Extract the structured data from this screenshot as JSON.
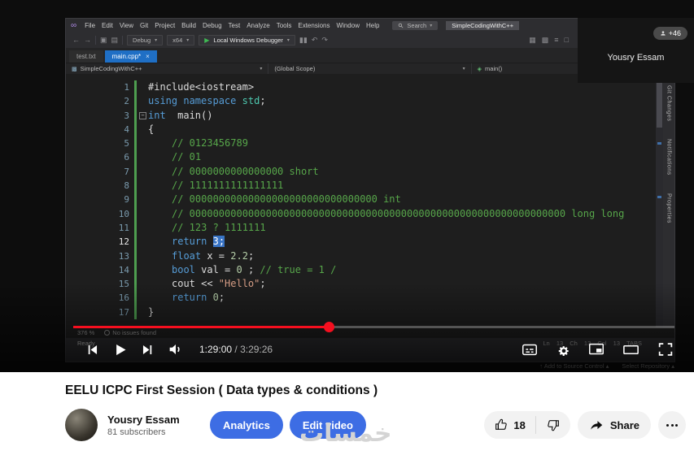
{
  "colors": {
    "accent_blue": "#3d6de4",
    "progress_red": "#f50f1f",
    "kw": "#569cd6",
    "comment": "#57a64a",
    "string": "#d69d85",
    "number": "#b5cea8",
    "selection": "#3873c4"
  },
  "video": {
    "overlay": {
      "badge": "+46",
      "presenter": "Yousry Essam"
    },
    "player": {
      "time_current": "1:29:00",
      "time_sep": " / ",
      "time_total": "3:29:26",
      "progress_pct": 42.5
    }
  },
  "vs": {
    "menus": [
      "File",
      "Edit",
      "View",
      "Git",
      "Project",
      "Build",
      "Debug",
      "Test",
      "Analyze",
      "Tools",
      "Extensions",
      "Window",
      "Help"
    ],
    "search_label": "Search",
    "account_label": "SimpleCodingWithC++",
    "toolbar": {
      "config": "Debug",
      "platform": "x64",
      "run": "Local Windows Debugger"
    },
    "tabs": [
      {
        "label": "test.txt"
      },
      {
        "label": "main.cpp*"
      }
    ],
    "breadcrumb": {
      "project": "SimpleCodingWithC++",
      "scope": "(Global Scope)",
      "symbol": "main()"
    },
    "right_tabs": [
      "Git Changes",
      "Notifications",
      "Properties"
    ],
    "status": {
      "zoom": "376 %",
      "issues": "No issues found",
      "ready": "Ready",
      "caret": "Ln 13 Ch 13 Col 13 TABS",
      "source_control": "Add to Source Control",
      "repository": "Select Repository"
    },
    "code": {
      "lines": [
        {
          "n": 1,
          "ind": 0,
          "segs": [
            [
              "pl",
              "#include<iostream>"
            ]
          ]
        },
        {
          "n": 2,
          "ind": 0,
          "segs": [
            [
              "kw",
              "using"
            ],
            [
              "pl",
              " "
            ],
            [
              "kw",
              "namespace"
            ],
            [
              "pl",
              " "
            ],
            [
              "ty",
              "std"
            ],
            [
              "pl",
              ";"
            ]
          ]
        },
        {
          "n": 3,
          "ind": 0,
          "fold": true,
          "segs": [
            [
              "kw",
              "int"
            ],
            [
              "pl",
              "  main()"
            ]
          ]
        },
        {
          "n": 4,
          "ind": 0,
          "segs": [
            [
              "pl",
              "{"
            ]
          ]
        },
        {
          "n": 5,
          "ind": 1,
          "segs": [
            [
              "cm",
              "// 0123456789"
            ]
          ]
        },
        {
          "n": 6,
          "ind": 1,
          "segs": [
            [
              "cm",
              "// 01"
            ]
          ]
        },
        {
          "n": 7,
          "ind": 1,
          "segs": [
            [
              "cm",
              "// 0000000000000000 short"
            ]
          ]
        },
        {
          "n": 8,
          "ind": 1,
          "segs": [
            [
              "cm",
              "// 1111111111111111"
            ]
          ]
        },
        {
          "n": 9,
          "ind": 1,
          "segs": [
            [
              "cm",
              "// 00000000000000000000000000000000 int"
            ]
          ]
        },
        {
          "n": 10,
          "ind": 1,
          "segs": [
            [
              "cm",
              "// 0000000000000000000000000000000000000000000000000000000000000000 long long"
            ]
          ]
        },
        {
          "n": 11,
          "ind": 1,
          "segs": [
            [
              "cm",
              "// 123 ? 1111111"
            ]
          ]
        },
        {
          "n": 12,
          "ind": 1,
          "cur": true,
          "segs": [
            [
              "kw",
              "return"
            ],
            [
              "pl",
              " "
            ],
            [
              "sel",
              "3;"
            ]
          ]
        },
        {
          "n": 13,
          "ind": 1,
          "segs": [
            [
              "kw",
              "float"
            ],
            [
              "pl",
              " x = "
            ],
            [
              "num",
              "2.2"
            ],
            [
              "pl",
              ";"
            ]
          ]
        },
        {
          "n": 14,
          "ind": 1,
          "segs": [
            [
              "kw",
              "bool"
            ],
            [
              "pl",
              " val = "
            ],
            [
              "num",
              "0"
            ],
            [
              "pl",
              " ; "
            ],
            [
              "cm",
              "// true = 1 /"
            ]
          ]
        },
        {
          "n": 15,
          "ind": 1,
          "segs": [
            [
              "pl",
              "cout << "
            ],
            [
              "str",
              "\"Hello\""
            ],
            [
              "pl",
              ";"
            ]
          ]
        },
        {
          "n": 16,
          "ind": 1,
          "segs": [
            [
              "kw",
              "return"
            ],
            [
              "pl",
              " "
            ],
            [
              "num",
              "0"
            ],
            [
              "pl",
              ";"
            ]
          ]
        },
        {
          "n": 17,
          "ind": 0,
          "segs": [
            [
              "pl",
              "}"
            ]
          ]
        }
      ]
    }
  },
  "page": {
    "title": "EELU ICPC First Session ( Data types & conditions )",
    "channel": {
      "name": "Yousry Essam",
      "subscribers": "81 subscribers"
    },
    "actions": {
      "analytics": "Analytics",
      "edit_video": "Edit video",
      "likes": "18",
      "share": "Share"
    },
    "watermark": "خمسات"
  }
}
